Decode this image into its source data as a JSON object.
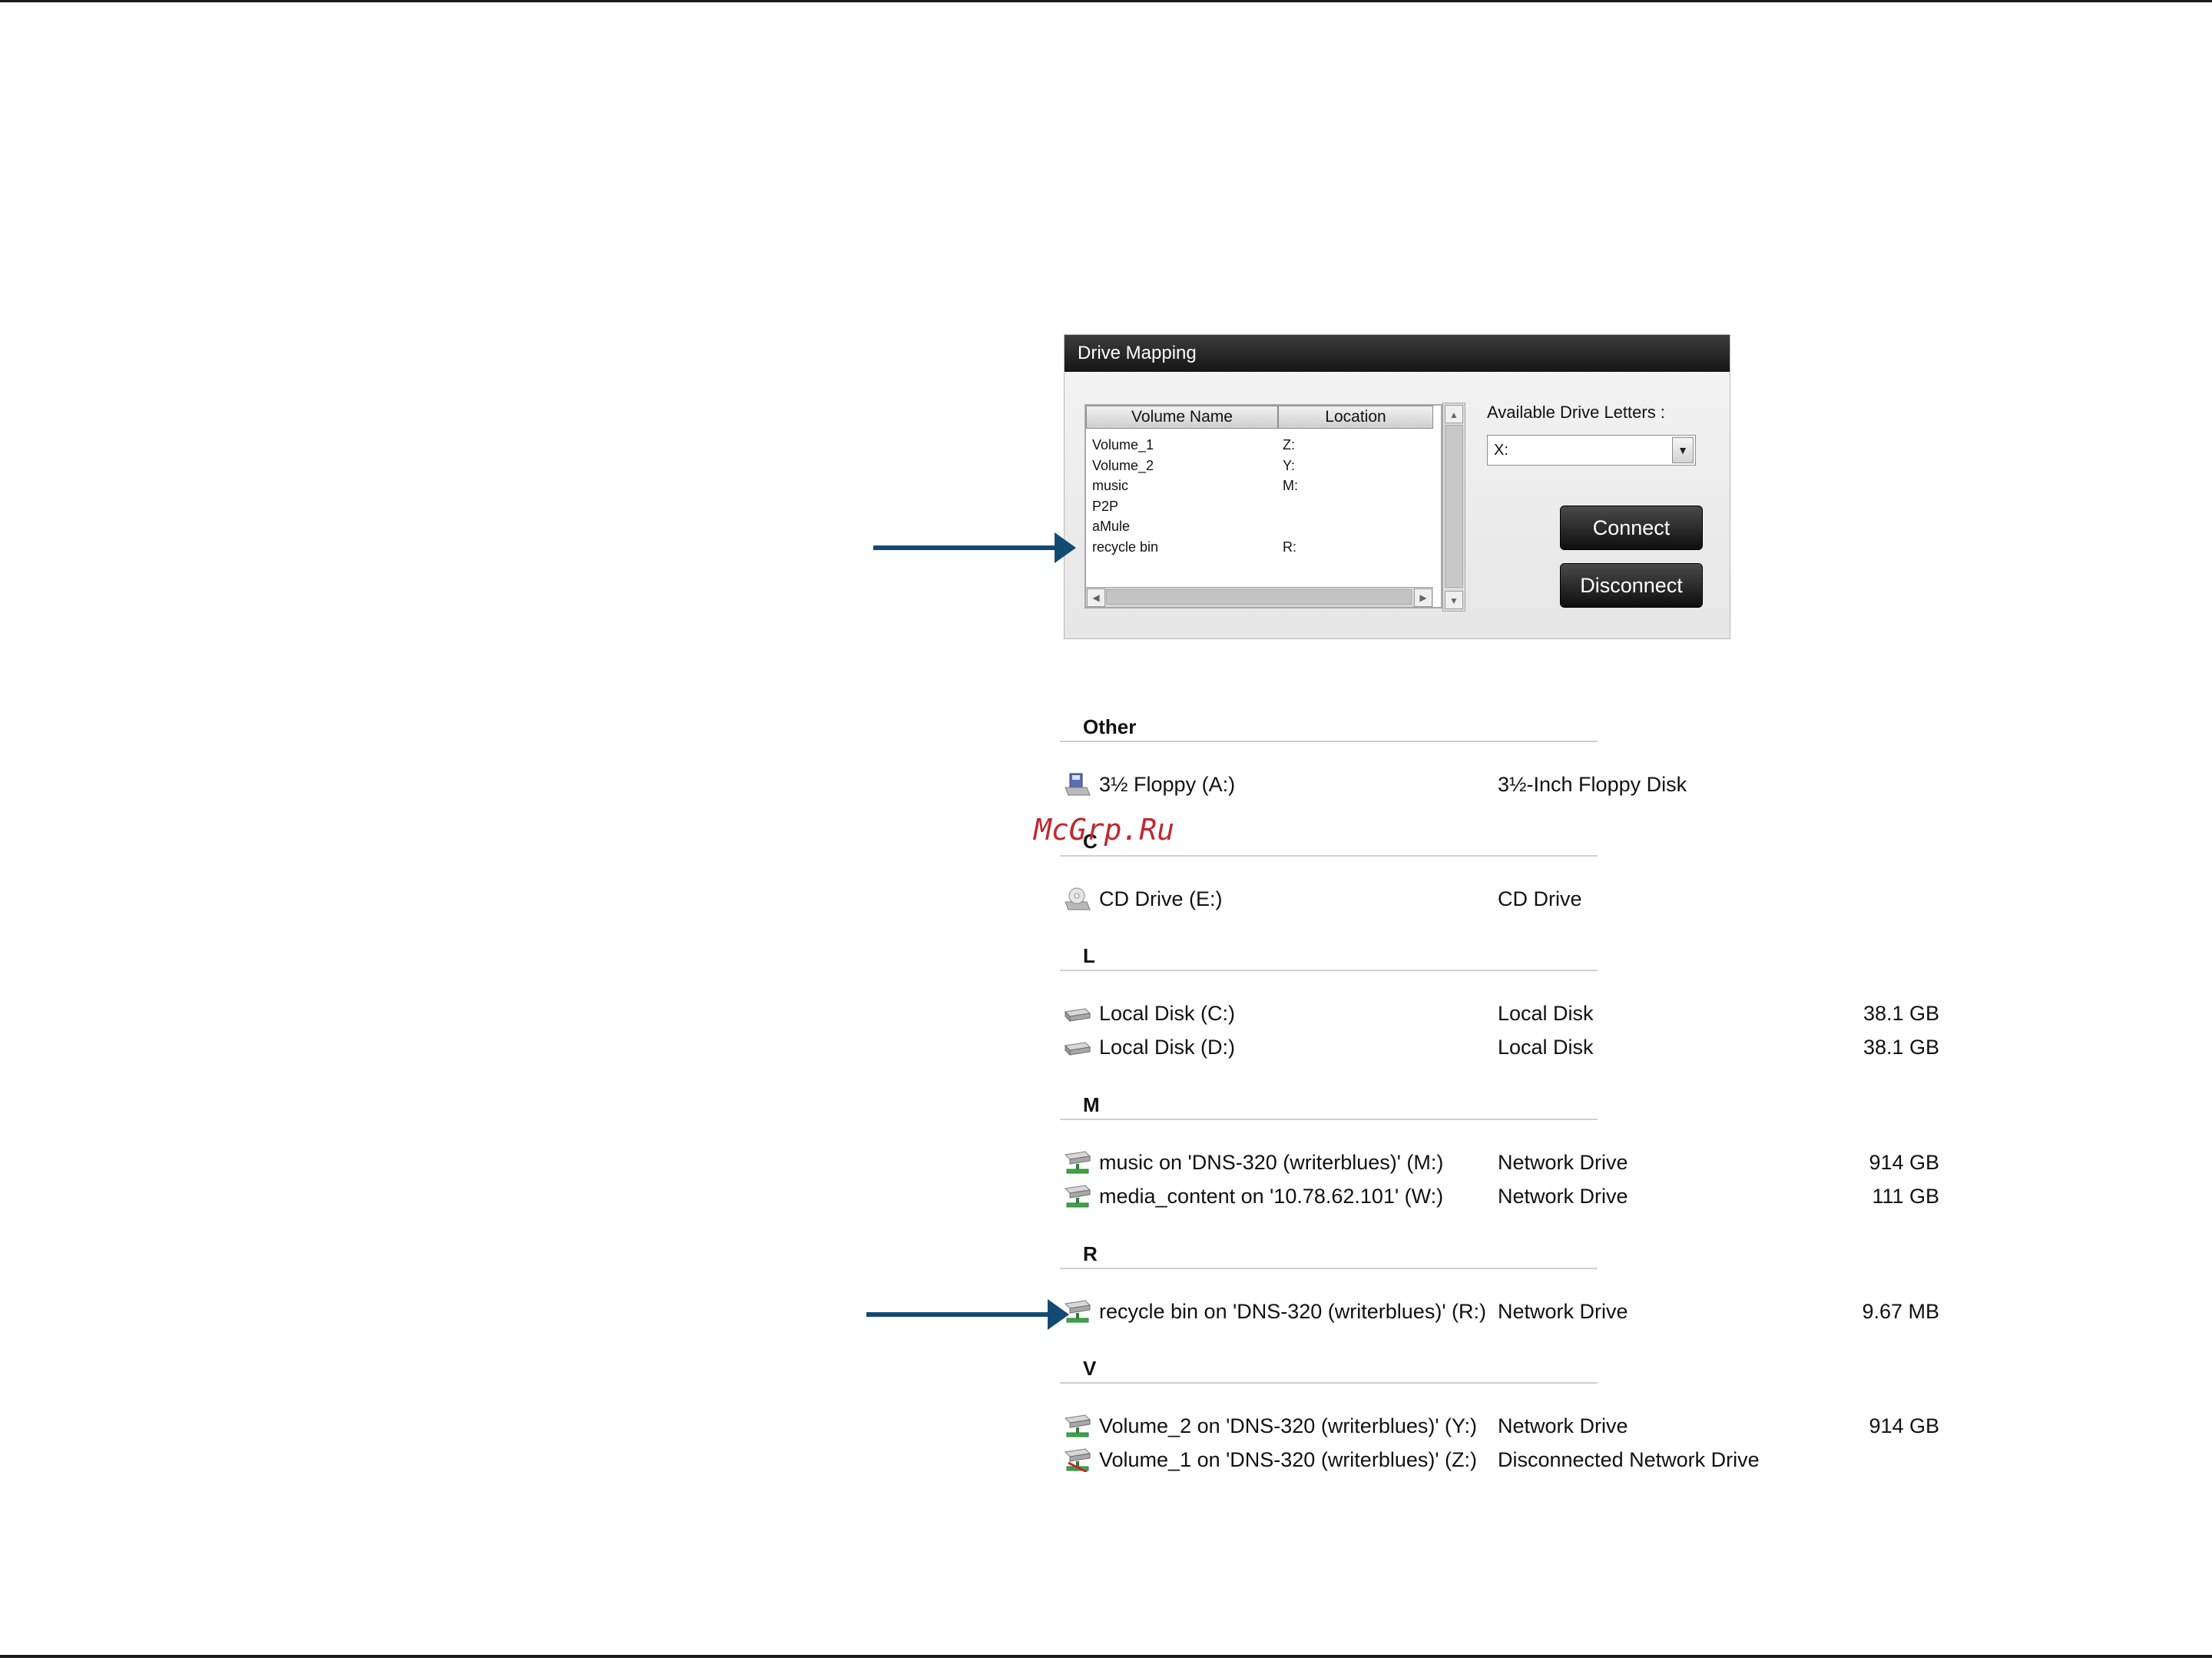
{
  "dialog": {
    "title": "Drive Mapping",
    "columns": {
      "volume": "Volume Name",
      "location": "Location"
    },
    "volumes": [
      {
        "name": "Volume_1",
        "location": "Z:"
      },
      {
        "name": "Volume_2",
        "location": "Y:"
      },
      {
        "name": "music",
        "location": "M:"
      },
      {
        "name": "P2P",
        "location": ""
      },
      {
        "name": "aMule",
        "location": ""
      },
      {
        "name": "recycle bin",
        "location": "R:"
      }
    ],
    "available_label": "Available Drive Letters :",
    "selected_letter": "X:",
    "connect_label": "Connect",
    "disconnect_label": "Disconnect"
  },
  "explorer": {
    "groups": [
      {
        "header": "Other",
        "items": [
          {
            "name": "3½ Floppy (A:)",
            "type": "3½-Inch Floppy Disk",
            "size": "",
            "icon": "floppy-icon"
          }
        ]
      },
      {
        "header": "C",
        "items": [
          {
            "name": "CD Drive (E:)",
            "type": "CD Drive",
            "size": "",
            "icon": "cd-drive-icon"
          }
        ]
      },
      {
        "header": "L",
        "items": [
          {
            "name": "Local Disk (C:)",
            "type": "Local Disk",
            "size": "38.1 GB",
            "icon": "local-disk-icon"
          },
          {
            "name": "Local Disk (D:)",
            "type": "Local Disk",
            "size": "38.1 GB",
            "icon": "local-disk-icon"
          }
        ]
      },
      {
        "header": "M",
        "items": [
          {
            "name": "music on 'DNS-320 (writerblues)' (M:)",
            "type": "Network Drive",
            "size": "914 GB",
            "icon": "network-drive-icon"
          },
          {
            "name": "media_content on '10.78.62.101' (W:)",
            "type": "Network Drive",
            "size": "111 GB",
            "icon": "network-drive-icon"
          }
        ]
      },
      {
        "header": "R",
        "items": [
          {
            "name": "recycle bin on 'DNS-320 (writerblues)' (R:)",
            "type": "Network Drive",
            "size": "9.67 MB",
            "icon": "network-drive-icon"
          }
        ]
      },
      {
        "header": "V",
        "items": [
          {
            "name": "Volume_2 on 'DNS-320 (writerblues)' (Y:)",
            "type": "Network Drive",
            "size": "914 GB",
            "icon": "network-drive-icon"
          },
          {
            "name": "Volume_1 on 'DNS-320 (writerblues)' (Z:)",
            "type": "Disconnected Network Drive",
            "size": "",
            "icon": "disconnected-network-drive-icon"
          }
        ]
      }
    ]
  },
  "watermark": "McGrp.Ru",
  "colors": {
    "arrow": "#134a73",
    "dialog_title_bg": "#1f1f1f",
    "watermark": "#c1272d"
  }
}
